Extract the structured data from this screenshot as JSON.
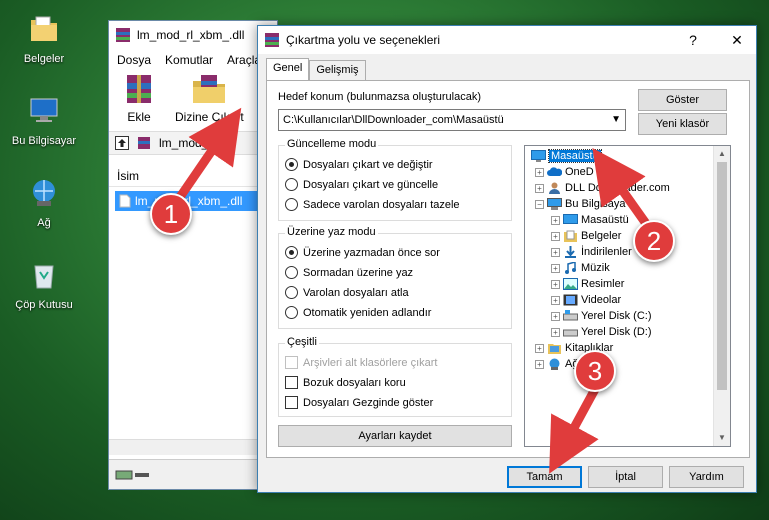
{
  "desktop": {
    "icons": [
      {
        "label": "Belgeler",
        "icon": "documents-folder-icon"
      },
      {
        "label": "Bu Bilgisayar",
        "icon": "computer-icon"
      },
      {
        "label": "Ağ",
        "icon": "network-icon"
      },
      {
        "label": "Çöp Kutusu",
        "icon": "recycle-bin-icon"
      }
    ]
  },
  "winrar": {
    "title": "lm_mod_rl_xbm_.dll",
    "menu": [
      "Dosya",
      "Komutlar",
      "Araçla"
    ],
    "toolbar": {
      "add_label": "Ekle",
      "extract_label": "Dizine Çıkart"
    },
    "address": "lm_mod_rl_",
    "column_name": "İsim",
    "file": "lm_mod_rl_xbm_.dll"
  },
  "dialog": {
    "title": "Çıkartma yolu ve seçenekleri",
    "help": "?",
    "close": "✕",
    "tabs": [
      "Genel",
      "Gelişmiş"
    ],
    "dest_label": "Hedef konum (bulunmazsa oluşturulacak)",
    "dest_value": "C:\\Kullanıcılar\\DllDownloader_com\\Masaüstü",
    "show_button": "Göster",
    "new_folder_button": "Yeni klasör",
    "update_mode": {
      "title": "Güncelleme modu",
      "options": [
        "Dosyaları çıkart ve değiştir",
        "Dosyaları çıkart ve güncelle",
        "Sadece varolan dosyaları tazele"
      ],
      "selected": 0
    },
    "overwrite_mode": {
      "title": "Üzerine yaz modu",
      "options": [
        "Üzerine yazmadan önce sor",
        "Sormadan üzerine yaz",
        "Varolan dosyaları atla",
        "Otomatik yeniden adlandır"
      ],
      "selected": 0
    },
    "misc": {
      "title": "Çeşitli",
      "options": [
        "Arşivleri alt klasörlere çıkart",
        "Bozuk dosyaları koru",
        "Dosyaları Gezginde göster"
      ]
    },
    "save_settings": "Ayarları kaydet",
    "tree": [
      {
        "label": "Masaüstü",
        "icon": "desktop-folder-icon",
        "selected": true
      },
      {
        "label": "OneD",
        "icon": "onedrive-icon"
      },
      {
        "label": "DLL Downloader.com",
        "icon": "user-folder-icon"
      },
      {
        "label": "Bu Bilgisaya",
        "icon": "computer-icon"
      },
      {
        "label": "Masaüstü",
        "icon": "desktop-folder-icon"
      },
      {
        "label": "Belgeler",
        "icon": "documents-icon"
      },
      {
        "label": "İndirilenler",
        "icon": "downloads-icon"
      },
      {
        "label": "Müzik",
        "icon": "music-icon"
      },
      {
        "label": "Resimler",
        "icon": "pictures-icon"
      },
      {
        "label": "Videolar",
        "icon": "videos-icon"
      },
      {
        "label": "Yerel Disk (C:)",
        "icon": "drive-icon"
      },
      {
        "label": "Yerel Disk (D:)",
        "icon": "drive-icon"
      },
      {
        "label": "Kitaplıklar",
        "icon": "library-icon"
      },
      {
        "label": "Ağ",
        "icon": "network-icon"
      }
    ],
    "ok_button": "Tamam",
    "cancel_button": "İptal",
    "help_button": "Yardım"
  },
  "steps": [
    "1",
    "2",
    "3"
  ],
  "colors": {
    "accent": "#0078d7",
    "badge": "#e03c3c"
  }
}
